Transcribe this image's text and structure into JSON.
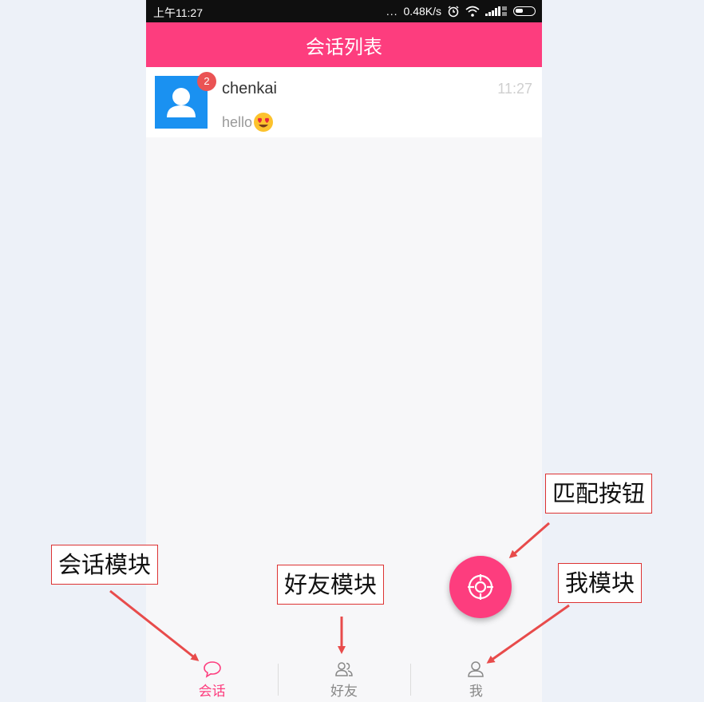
{
  "status_bar": {
    "time": "上午11:27",
    "speed": "0.48K/s",
    "dots": "..."
  },
  "header": {
    "title": "会话列表"
  },
  "conversations": [
    {
      "name": "chenkai",
      "time": "11:27",
      "last_message": "hello",
      "unread": "2",
      "avatar_icon": "user-avatar-icon",
      "emoji": "heart-eyes-emoji"
    }
  ],
  "fab": {
    "icon": "target-icon"
  },
  "nav": {
    "items": [
      {
        "label": "会话",
        "icon": "chat-bubble-icon",
        "active": true
      },
      {
        "label": "好友",
        "icon": "friends-icon",
        "active": false
      },
      {
        "label": "我",
        "icon": "person-icon",
        "active": false
      }
    ]
  },
  "annotations": {
    "match": "匹配按钮",
    "conversation": "会话模块",
    "friends": "好友模块",
    "me": "我模块"
  },
  "colors": {
    "accent": "#fd3d7e",
    "avatar": "#1a91f1",
    "badge": "#ea5354",
    "annotation": "#e84b4b"
  }
}
